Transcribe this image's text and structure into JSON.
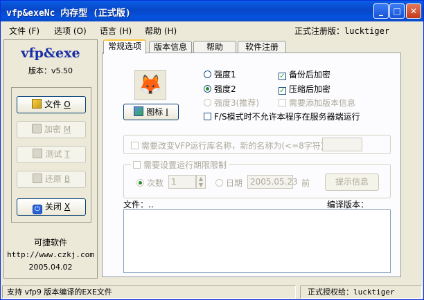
{
  "window": {
    "title": "vfp&exeNc 内存型 (正式版)",
    "controls": {
      "minimize": "_",
      "maximize": "□",
      "close": "✕"
    }
  },
  "menu": {
    "items": [
      {
        "label": "文件 (F)"
      },
      {
        "label": "选项 (O)"
      },
      {
        "label": "语言 (H)"
      },
      {
        "label": "帮助 (H)"
      }
    ],
    "edition_label": "正式注册版：",
    "edition_user": "lucktiger"
  },
  "sidebar": {
    "logo": "vfp&exe",
    "version": "版本：v5.50",
    "buttons": [
      {
        "label": "文件",
        "key": "O",
        "icon": "folder-icon",
        "enabled": true
      },
      {
        "label": "加密",
        "key": "M",
        "icon": "lock-icon",
        "enabled": false
      },
      {
        "label": "测试",
        "key": "T",
        "icon": "test-icon",
        "enabled": false
      },
      {
        "label": "还原",
        "key": "B",
        "icon": "restore-icon",
        "enabled": false
      },
      {
        "label": "关闭",
        "key": "X",
        "icon": "power-icon",
        "enabled": true
      }
    ],
    "company": "可捷软件",
    "website": "http://www.czkj.com",
    "date": "2005.04.02"
  },
  "tabs": [
    {
      "label": "常规选项",
      "active": true
    },
    {
      "label": "版本信息",
      "active": false
    },
    {
      "label": "帮助",
      "active": false
    },
    {
      "label": "软件注册",
      "active": false
    }
  ],
  "general": {
    "icon_button": {
      "label": "图标",
      "key": "I"
    },
    "strength": [
      {
        "label": "强度1",
        "checked": false,
        "enabled": true
      },
      {
        "label": "强度2",
        "checked": true,
        "enabled": true
      },
      {
        "label": "强度3(推荐)",
        "checked": false,
        "enabled": false
      }
    ],
    "options": [
      {
        "label": "备份后加密",
        "checked": true,
        "enabled": true
      },
      {
        "label": "压缩后加密",
        "checked": true,
        "enabled": true
      },
      {
        "label": "需要添加版本信息",
        "checked": false,
        "enabled": false
      }
    ],
    "fs_mode": {
      "label": "F/S模式时不允许本程序在服务器端运行",
      "checked": false
    },
    "rename_runtime": {
      "label": "需要改变VFP运行库名称，新的名称为(<=8字符)",
      "value": ""
    },
    "time_limit": {
      "legend": "需要设置运行期限限制",
      "count_label": "次数",
      "count_value": "1",
      "date_label": "日期",
      "date_value": "2005.05.23",
      "before_label": "前",
      "tip_button": "提示信息"
    },
    "file_header": "文件：..",
    "compile_header": "编译版本："
  },
  "status": {
    "left": "支持 vfp9 版本编译的EXE文件",
    "right_label": "正式授权给：",
    "right_user": "lucktiger"
  }
}
